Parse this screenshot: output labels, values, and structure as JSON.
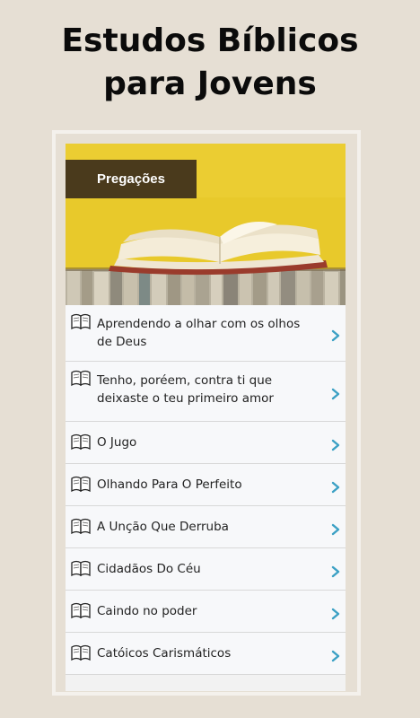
{
  "headline": {
    "line1": "Estudos Bíblicos",
    "line2": "para Jovens"
  },
  "banner": {
    "title": "Pregações"
  },
  "list": {
    "items": [
      {
        "label": "Aprendendo a olhar com os olhos de Deus",
        "icon": "open-book-icon"
      },
      {
        "label": "Tenho, poréem, contra ti que deixaste o teu primeiro amor",
        "icon": "open-book-icon"
      },
      {
        "label": "O Jugo",
        "icon": "open-book-icon"
      },
      {
        "label": "Olhando Para O Perfeito",
        "icon": "open-book-icon"
      },
      {
        "label": "A Unção Que Derruba",
        "icon": "open-book-icon"
      },
      {
        "label": "Cidadãos Do Céu",
        "icon": "open-book-icon"
      },
      {
        "label": "Caindo no poder",
        "icon": "open-book-icon"
      },
      {
        "label": "Catóicos Carismáticos",
        "icon": "open-book-icon"
      }
    ]
  },
  "colors": {
    "background": "#e6dfd4",
    "banner_yellow": "#e7c82c",
    "title_box": "#4a3a1c",
    "chevron": "#3ba0c4"
  }
}
